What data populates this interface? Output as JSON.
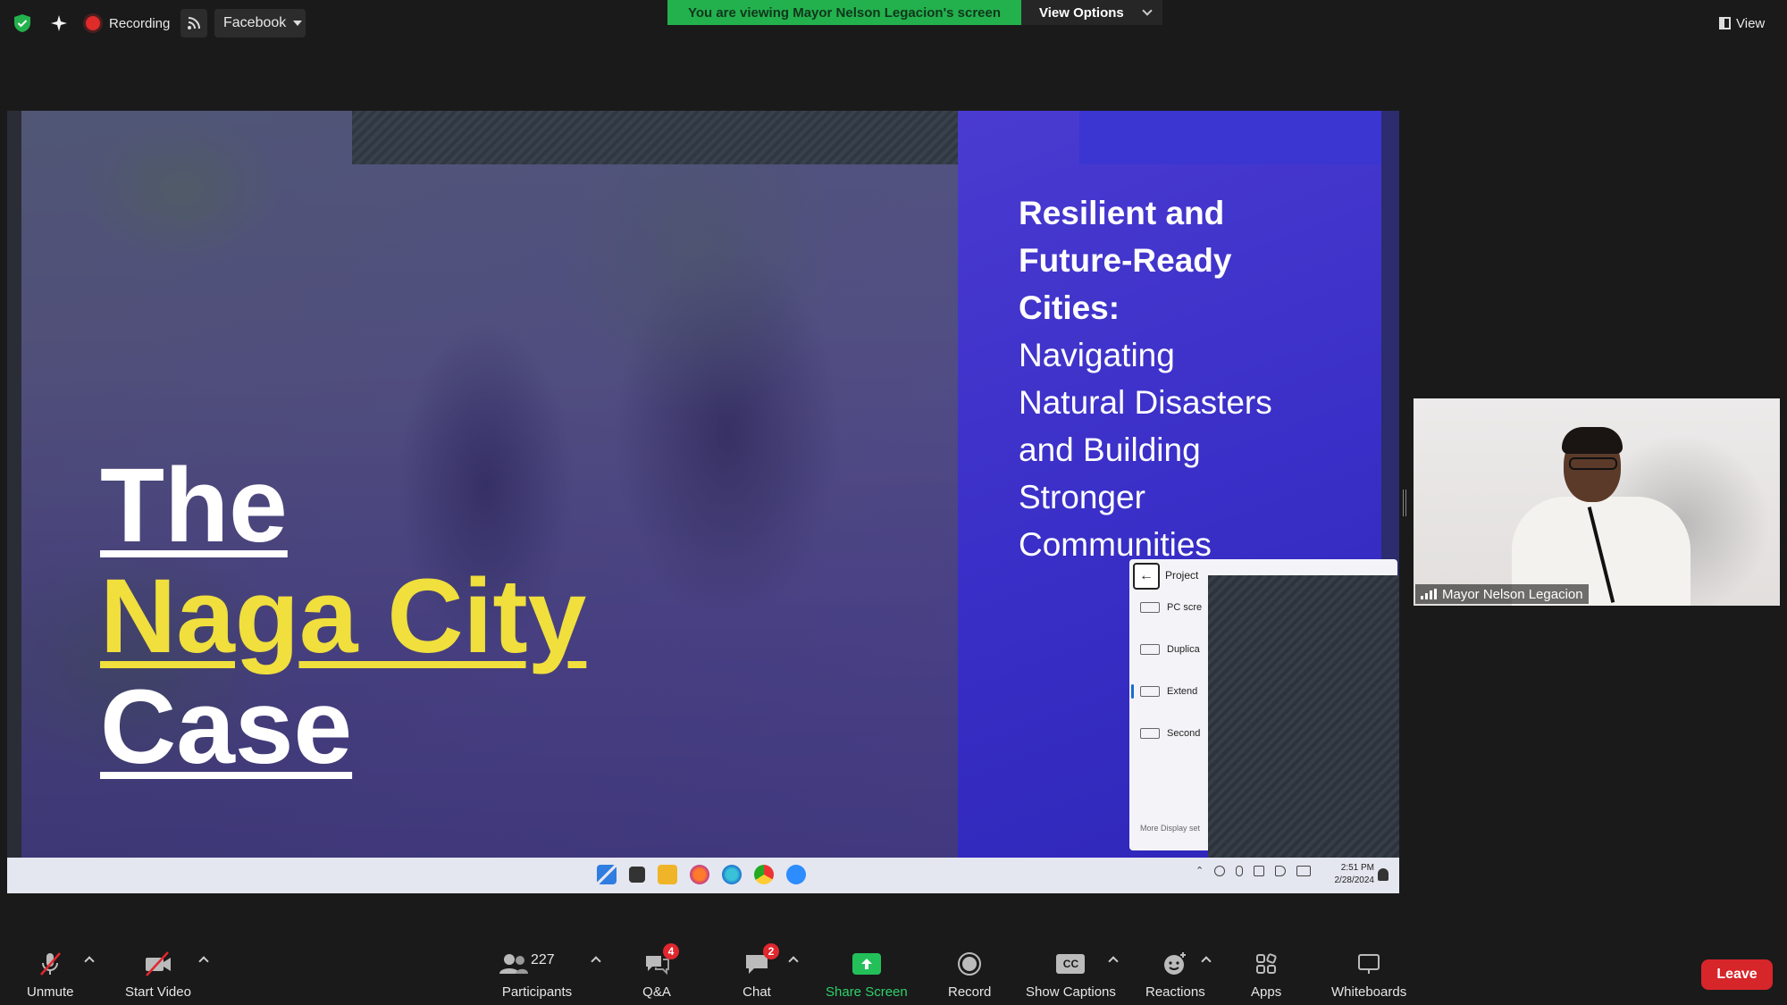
{
  "topbar": {
    "recording_label": "Recording",
    "facebook_label": "Facebook",
    "viewing_banner": "You are viewing Mayor Nelson Legacion's screen",
    "view_options_label": "View Options",
    "view_label": "View"
  },
  "slide": {
    "title_bold": [
      "Resilient and",
      "Future-Ready",
      "Cities:"
    ],
    "title_light": [
      "Navigating",
      "Natural Disasters",
      "and Building",
      "Stronger",
      "Communities"
    ],
    "case_line1": "The",
    "case_line2": "Naga City",
    "case_line3": "Case",
    "accent_color": "#f0df3c",
    "panel_color": "#3a2fc8"
  },
  "project_panel": {
    "title": "Project",
    "items": [
      "PC scre",
      "Duplica",
      "Extend",
      "Second"
    ],
    "selected_index": 2,
    "more_label": "More Display set"
  },
  "taskbar": {
    "time": "2:51 PM",
    "date": "2/28/2024"
  },
  "video": {
    "participant_name": "Mayor Nelson Legacion"
  },
  "toolbar": {
    "unmute_label": "Unmute",
    "start_video_label": "Start Video",
    "participants_label": "Participants",
    "participants_count": "227",
    "qa_label": "Q&A",
    "qa_badge": "4",
    "chat_label": "Chat",
    "chat_badge": "2",
    "share_screen_label": "Share Screen",
    "record_label": "Record",
    "captions_label": "Show Captions",
    "captions_icon_text": "CC",
    "reactions_label": "Reactions",
    "apps_label": "Apps",
    "whiteboards_label": "Whiteboards",
    "leave_label": "Leave"
  }
}
